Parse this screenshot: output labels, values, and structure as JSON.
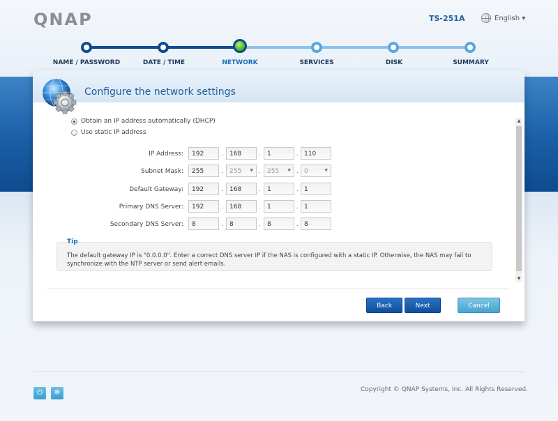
{
  "header": {
    "logo_text": "QNAP",
    "model": "TS-251A",
    "language": "English ▾"
  },
  "stepper": {
    "steps": [
      {
        "label": "NAME / PASSWORD",
        "state": "done"
      },
      {
        "label": "DATE / TIME",
        "state": "done"
      },
      {
        "label": "NETWORK",
        "state": "current"
      },
      {
        "label": "SERVICES",
        "state": "todo"
      },
      {
        "label": "DISK",
        "state": "todo"
      },
      {
        "label": "SUMMARY",
        "state": "todo"
      }
    ]
  },
  "panel": {
    "title": "Configure the network settings",
    "icon": "network-settings-gear-globe-icon",
    "radio_options": [
      {
        "label": "Obtain an IP address automatically (DHCP)",
        "checked": true
      },
      {
        "label": "Use static IP address",
        "checked": false
      }
    ],
    "fields": [
      {
        "label": "IP Address:",
        "octets": [
          "192",
          "168",
          "1",
          "110"
        ]
      },
      {
        "label": "Subnet Mask:",
        "octets": [
          "255",
          "255",
          "255",
          "0"
        ]
      },
      {
        "label": "Default Gateway:",
        "octets": [
          "192",
          "168",
          "1",
          "1"
        ]
      },
      {
        "label": "Primary DNS Server:",
        "octets": [
          "192",
          "168",
          "1",
          "1"
        ]
      },
      {
        "label": "Secondary DNS Server:",
        "octets": [
          "8",
          "8",
          "8",
          "8"
        ]
      }
    ],
    "tip": {
      "title": "Tip",
      "text": "The default gateway IP is \"0.0.0.0\". Enter a correct DNS server IP if the NAS is configured with a static IP. Otherwise, the NAS may fail to synchronize with the NTP server or send alert emails."
    },
    "buttons": {
      "back": "Back",
      "next": "Next",
      "cancel": "Cancel"
    }
  },
  "footer": {
    "copyright": "Copyright © QNAP Systems, Inc. All Rights Reserved.",
    "power_icon": "⏻",
    "settings_icon": "✲"
  },
  "colors": {
    "accent": "#1e5f9e",
    "primary_button": "#1a5fa6",
    "cancel_button": "#5ab0d8",
    "current_step": "#53b52a"
  }
}
